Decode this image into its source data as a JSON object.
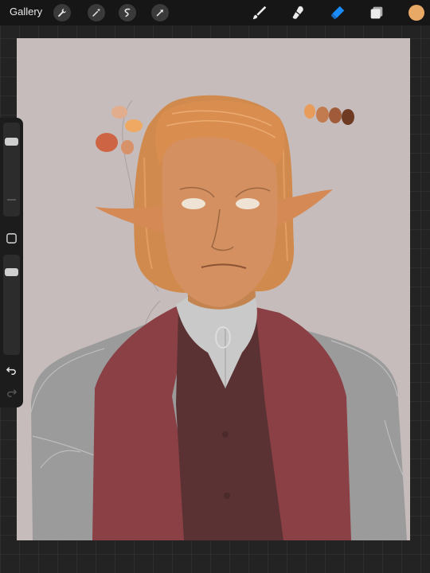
{
  "topbar": {
    "gallery_label": "Gallery",
    "tools_left": [
      "wrench-icon",
      "magic-wand-icon",
      "selection-icon",
      "transform-arrow-icon"
    ],
    "tools_right": [
      "brush-icon",
      "smudge-icon",
      "eraser-icon",
      "layers-icon"
    ],
    "active_tool": "eraser",
    "current_color": "#e8a866"
  },
  "canvas": {
    "background_color": "#c7bcbc",
    "palette_swatches_left": [
      "#e2ad8c",
      "#f0a962",
      "#cd6545",
      "#d8926a"
    ],
    "palette_swatches_right": [
      "#e89c5c",
      "#c27a4f",
      "#a05c3a",
      "#6e3b22"
    ]
  },
  "sidebar": {
    "brush_size_level": 0.18,
    "opacity_level": 0.15,
    "buttons": [
      "modify-square-icon",
      "undo-icon",
      "redo-icon"
    ]
  },
  "colors": {
    "accent_blue": "#1a8cff",
    "vest_red": "#8a4044",
    "waistcoat": "#5a3234",
    "shirt_grey": "#9a9a9a"
  }
}
